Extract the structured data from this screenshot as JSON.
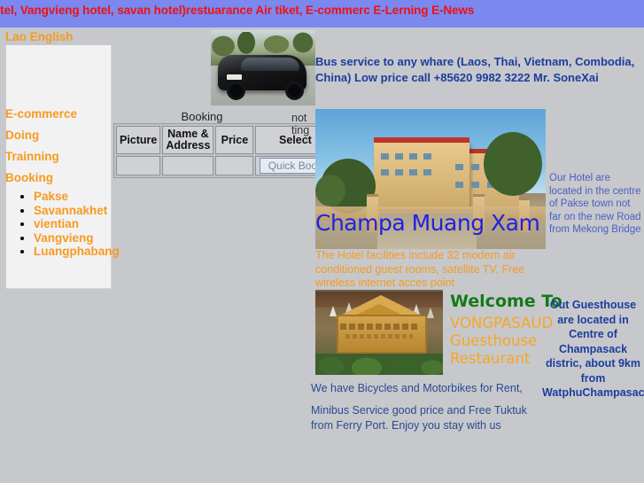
{
  "banner": {
    "text": "otel, Vangvieng hotel, savan hotel)restuarance Air tiket, E-commerc E-Lerning E-News",
    "bg_color": "#7b88f0",
    "text_color": "#ee1111"
  },
  "page": {
    "bg_color": "#c6c8cc"
  },
  "sidebar": {
    "language_bar": "Lao English",
    "links": [
      {
        "label": "E-commerce"
      },
      {
        "label": "Doing"
      },
      {
        "label": "Trainning"
      },
      {
        "label": "Booking"
      }
    ],
    "cities": [
      {
        "label": "Pakse"
      },
      {
        "label": "Savannakhet"
      },
      {
        "label": "vientian"
      },
      {
        "label": "Vangvieng"
      },
      {
        "label": "Luangphabang"
      }
    ],
    "link_color": "#f79a21"
  },
  "booking": {
    "title": "Booking",
    "side_note": "not ting",
    "columns": [
      "Picture",
      "Name & Address",
      "Price",
      "Select"
    ],
    "rows": [
      {
        "picture": "",
        "name_address": "",
        "price": "",
        "select_button": "Quick Book"
      }
    ]
  },
  "bus": {
    "text": "Bus service to any whare (Laos, Thai, Vietnam, Combodia, China) Low price call +85620 9982 3222 Mr. SoneXai",
    "text_color": "#1d3c9c"
  },
  "hotel": {
    "photo_alt": "champa-muang-xam-hotel-photo",
    "caption": "Champa Muang Xam Hotel",
    "caption_color": "#2222dd",
    "facilities": "The Hotel facilities include 32 modern air conditioned guest rooms, satellite TV, Free wireless internet acces point",
    "facilities_color": "#f79a21",
    "location": "Our Hotel are located in the centre of Pakse town not far on the new Road from Mekong Bridge",
    "location_color": "#4b5fc0"
  },
  "guesthouse": {
    "photo_alt": "vongpasaud-guesthouse-sign-photo",
    "welcome": "Welcome To",
    "welcome_color": "#157a17",
    "name": "VONGPASAUD Guesthouse Restaurant",
    "name_color": "#f7a623",
    "location": "Out Guesthouse are located in Centre of Champasack distric, about 9km from WatphuChampasack",
    "location_color": "#1d3c9c"
  },
  "services": {
    "rent": "We have Bicycles and Motorbikes for Rent,",
    "minibus": "Minibus Service good price and Free Tuktuk from Ferry Port. Enjoy you stay with us",
    "text_color": "#2b4a8f"
  },
  "van": {
    "photo_alt": "black-minivan-photo"
  }
}
